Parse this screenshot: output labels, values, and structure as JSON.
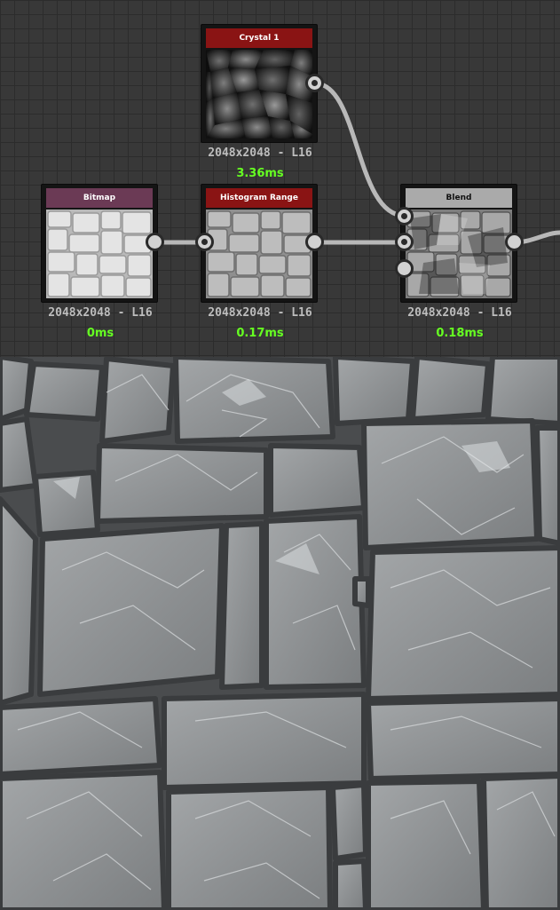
{
  "graph": {
    "nodes": {
      "crystal": {
        "title": "Crystal 1",
        "header_color": "#8a1414",
        "resolution": "2048x2048 - L16",
        "time": "3.36ms"
      },
      "bitmap": {
        "title": "Bitmap",
        "header_color": "#6b3a55",
        "resolution": "2048x2048 - L16",
        "time": "0ms"
      },
      "histogram": {
        "title": "Histogram Range",
        "header_color": "#8a1414",
        "resolution": "2048x2048 - L16",
        "time": "0.17ms"
      },
      "blend": {
        "title": "Blend",
        "header_color": "#aaaaaa",
        "resolution": "2048x2048 - L16",
        "time": "0.18ms"
      }
    },
    "colors": {
      "background": "#383838",
      "wire": "#b8b8b8",
      "time_text": "#66ff22",
      "resolution_text": "#bdbdbd",
      "port": "#d2d2d2"
    }
  },
  "viewport": {
    "description_icon": "stone-wall-render",
    "colors": {
      "stone": "#8f9294",
      "crack": "#3e4042",
      "highlight": "#d6d9db"
    }
  }
}
